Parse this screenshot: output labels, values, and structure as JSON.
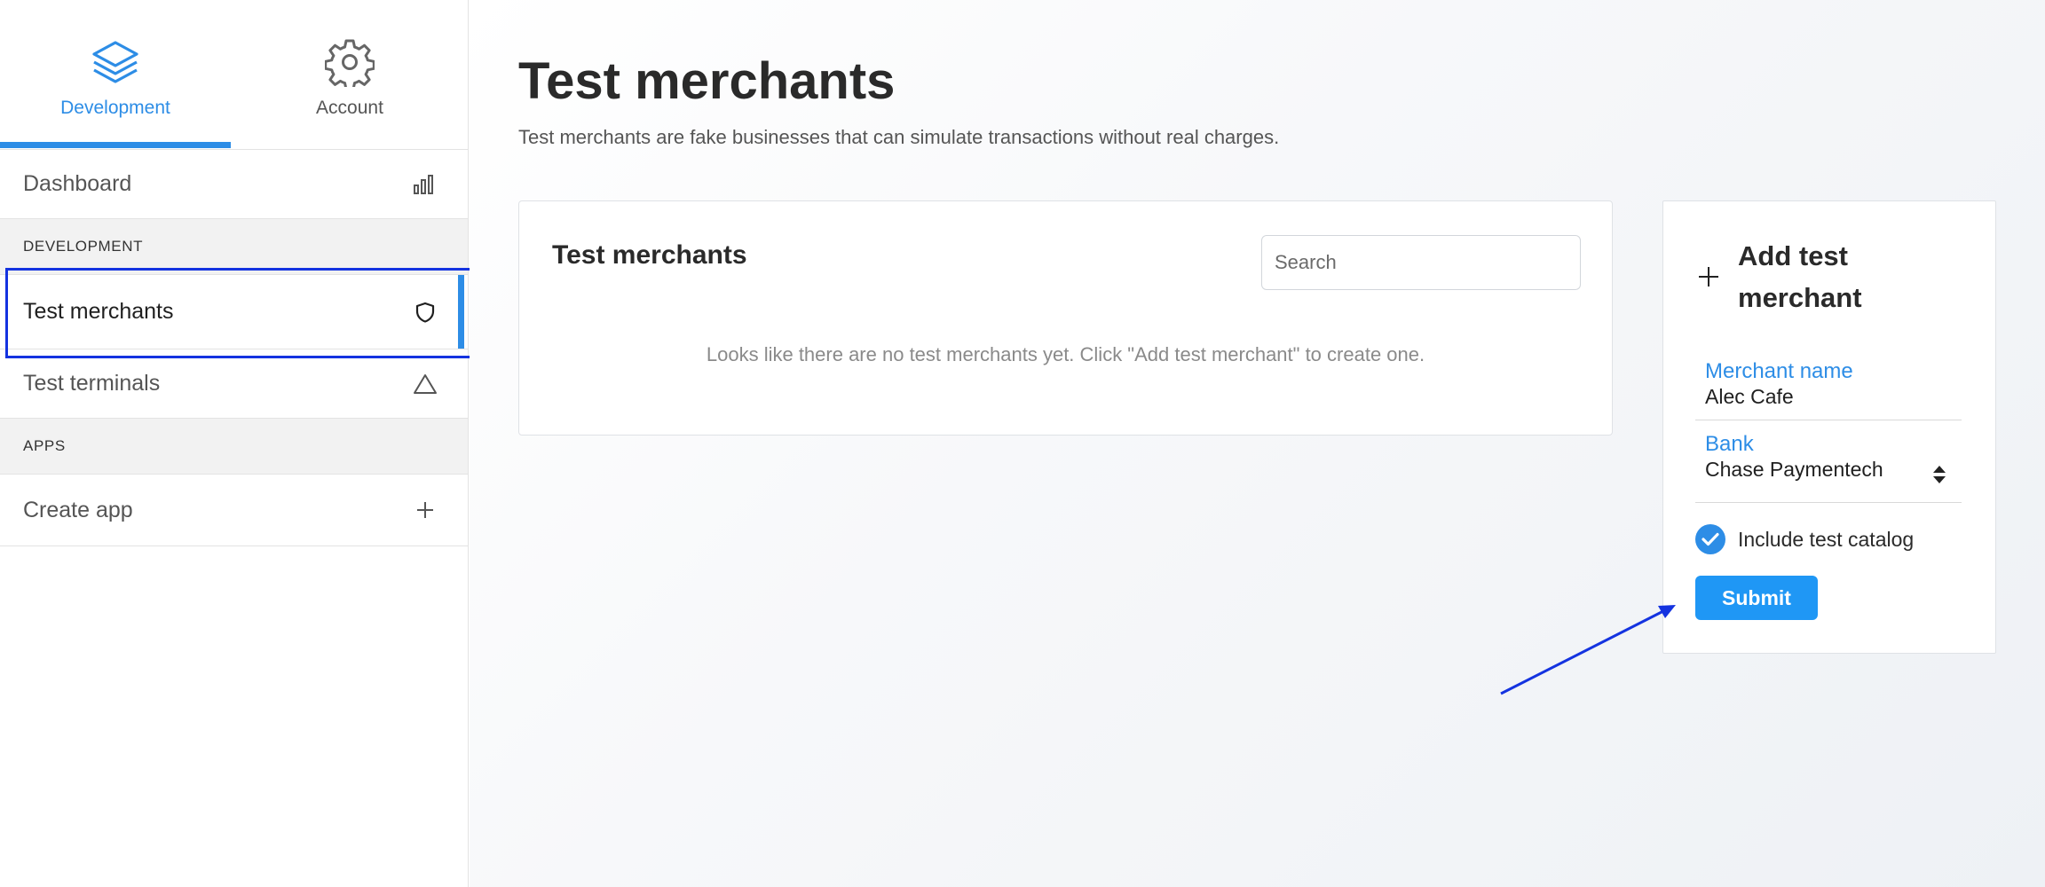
{
  "sidebar": {
    "tabs": [
      {
        "label": "Development",
        "icon": "layers-icon",
        "active": true
      },
      {
        "label": "Account",
        "icon": "gear-icon",
        "active": false
      }
    ],
    "items": {
      "dashboard": {
        "label": "Dashboard",
        "icon": "bar-chart-icon"
      },
      "section_development": "DEVELOPMENT",
      "test_merchants": {
        "label": "Test merchants",
        "icon": "shield-icon",
        "active": true
      },
      "test_terminals": {
        "label": "Test terminals",
        "icon": "triangle-icon"
      },
      "section_apps": "APPS",
      "create_app": {
        "label": "Create app",
        "icon": "plus-icon"
      }
    }
  },
  "main": {
    "title": "Test merchants",
    "subtitle": "Test merchants are fake businesses that can simulate transactions without real charges.",
    "list_card": {
      "title": "Test merchants",
      "search_placeholder": "Search",
      "empty_message": "Looks like there are no test merchants yet. Click \"Add test merchant\" to create one."
    },
    "add_card": {
      "title": "Add test merchant",
      "merchant_name_label": "Merchant name",
      "merchant_name_value": "Alec Cafe",
      "bank_label": "Bank",
      "bank_value": "Chase Paymentech",
      "include_catalog_label": "Include test catalog",
      "include_catalog_checked": true,
      "submit_label": "Submit"
    }
  },
  "colors": {
    "accent": "#2d8de6",
    "submit": "#1f97f5",
    "annotation": "#1433e0"
  }
}
